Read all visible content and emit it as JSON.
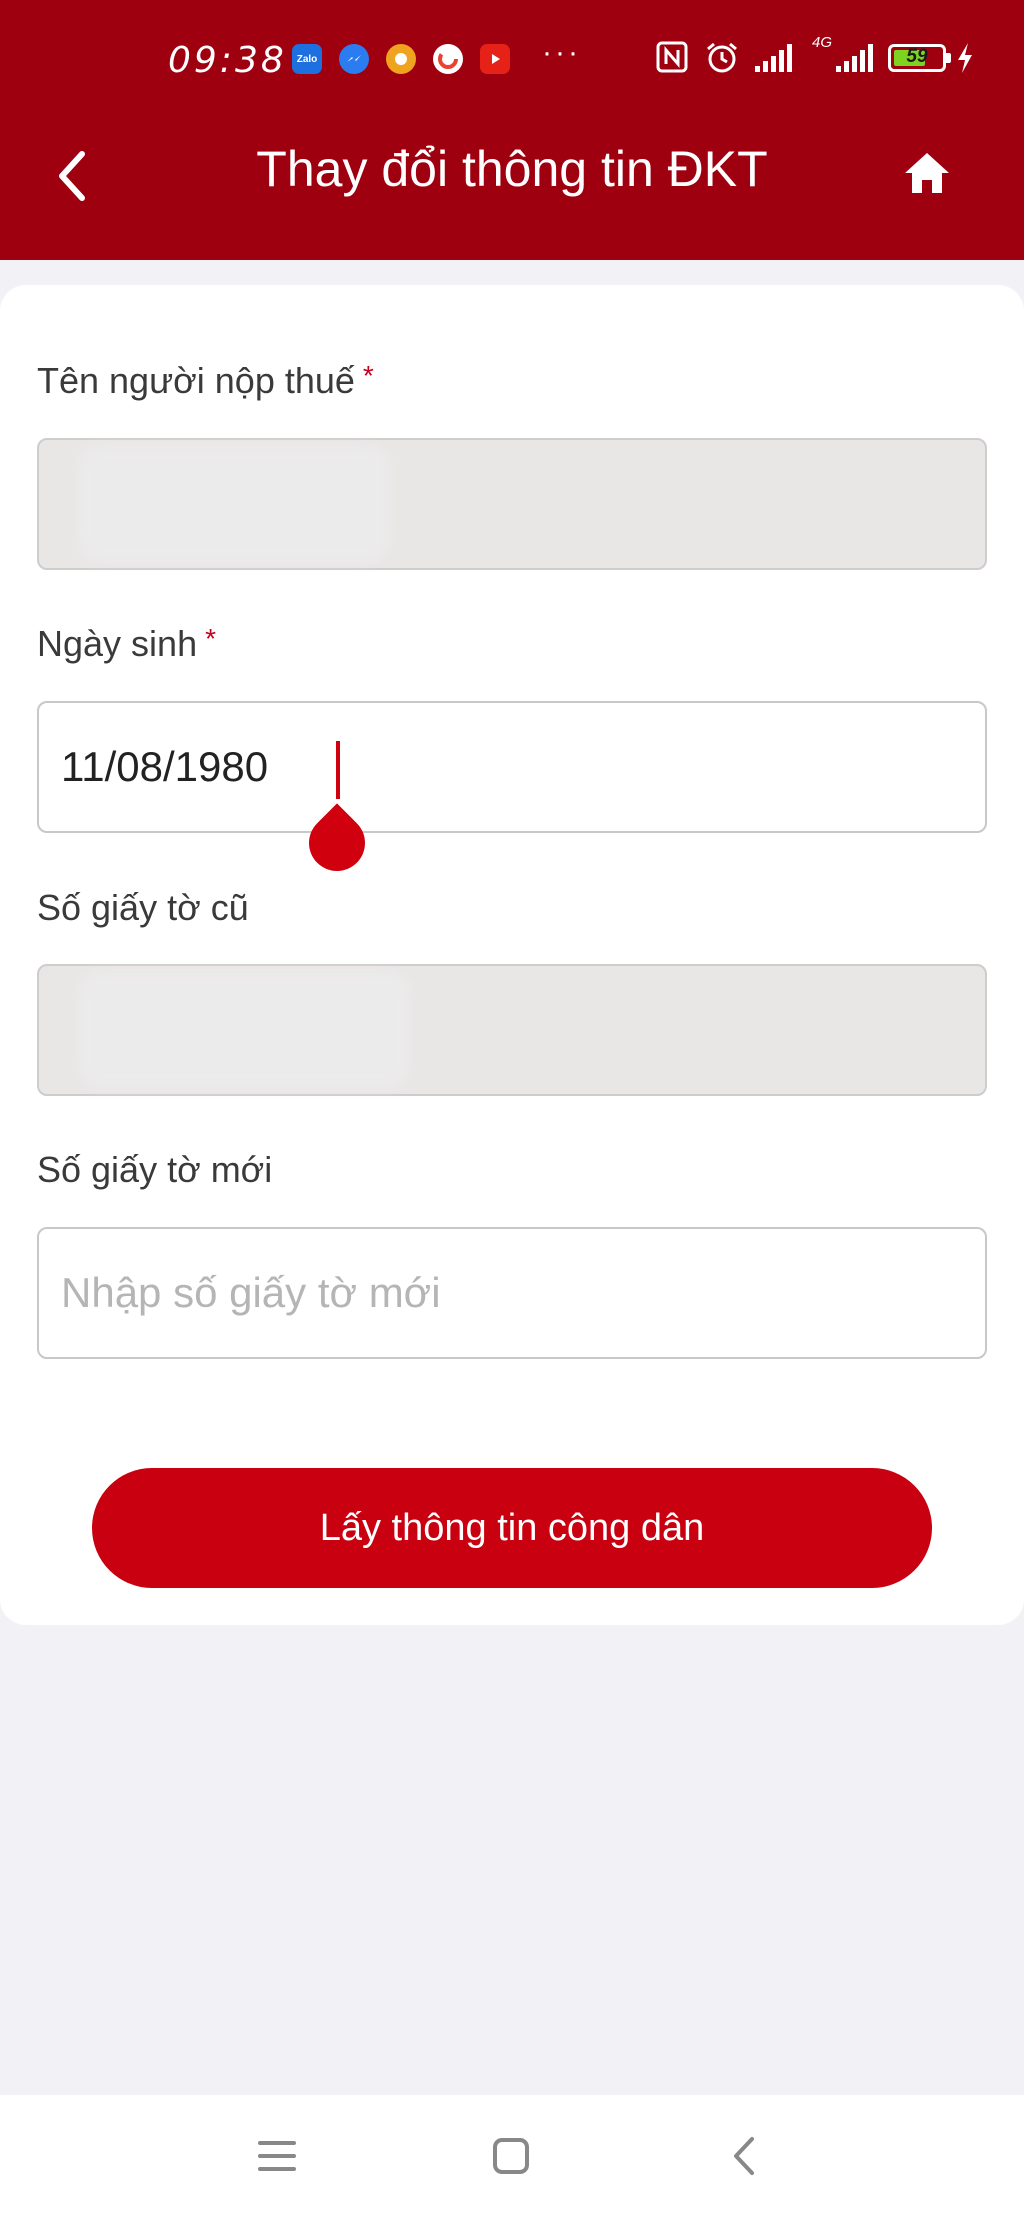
{
  "status_bar": {
    "time": "09:38",
    "app_icons": [
      "zalo-icon",
      "messenger-icon",
      "chrome-icon",
      "google-icon",
      "youtube-icon"
    ],
    "zalo_label": "Zalo",
    "more": "···",
    "network": "4G",
    "battery": "59",
    "battery_level": 0.59
  },
  "header": {
    "title": "Thay đổi thông tin ĐKT"
  },
  "form": {
    "taxpayer_name": {
      "label": "Tên người nộp thuế",
      "required_mark": "*"
    },
    "birth_date": {
      "label": "Ngày sinh",
      "required_mark": "*",
      "value": "11/08/1980"
    },
    "old_document": {
      "label": "Số giấy tờ cũ"
    },
    "new_document": {
      "label": "Số giấy tờ mới",
      "placeholder": "Nhập số giấy tờ mới"
    }
  },
  "actions": {
    "submit_label": "Lấy thông tin công dân"
  },
  "colors": {
    "header_bg": "#9e0010",
    "accent": "#c8000f",
    "page_bg": "#f2f2f6"
  }
}
